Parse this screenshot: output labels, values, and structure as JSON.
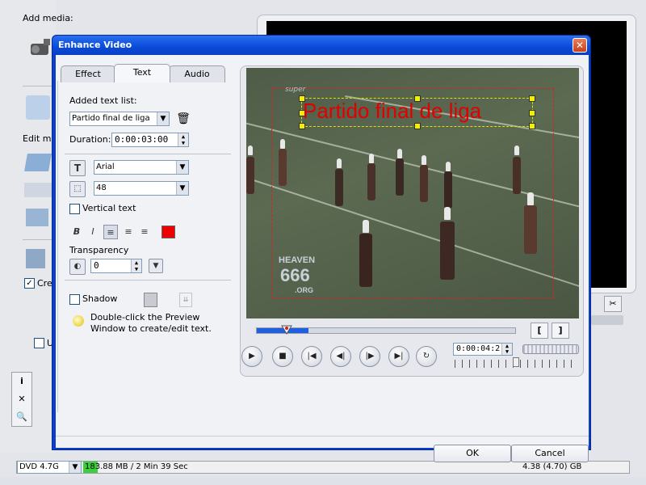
{
  "background_app": {
    "add_media_label": "Add media:",
    "edit_media_label": "Edit me",
    "create_label": "Cre",
    "underline_label": "U",
    "disc_type": "DVD 4.7G",
    "space_used": "183.88 MB / 2 Min 39 Sec",
    "capacity": "4.38 (4.70) GB",
    "side_tools": [
      "i",
      "✕",
      "🔍"
    ]
  },
  "dialog": {
    "title": "Enhance Video",
    "close_symbol": "✕",
    "tabs": [
      "Effect",
      "Text",
      "Audio"
    ],
    "active_tab": "Text",
    "added_text_list_label": "Added text list:",
    "added_text_value": "Partido final de liga",
    "duration_label": "Duration:",
    "duration_value": "0:00:03:00",
    "font_icon": "T",
    "font_name": "Arial",
    "font_size": "48",
    "vertical_text_label": "Vertical text",
    "bold": "B",
    "italic": "I",
    "text_color": "#ee0000",
    "transparency_label": "Transparency",
    "transparency_value": "0",
    "shadow_label": "Shadow",
    "hint": "Double-click the Preview Window to create/edit text.",
    "ok_label": "OK",
    "cancel_label": "Cancel"
  },
  "preview": {
    "overlay_text": "Partido final de liga",
    "watermark_top": "HEAVEN",
    "watermark_mid": "666",
    "watermark_bot": ".ORG",
    "watermark_tag": "super",
    "mark_in": "[",
    "mark_out": "]",
    "timecode": "0:00:04:2",
    "playback_position": 0.2
  }
}
